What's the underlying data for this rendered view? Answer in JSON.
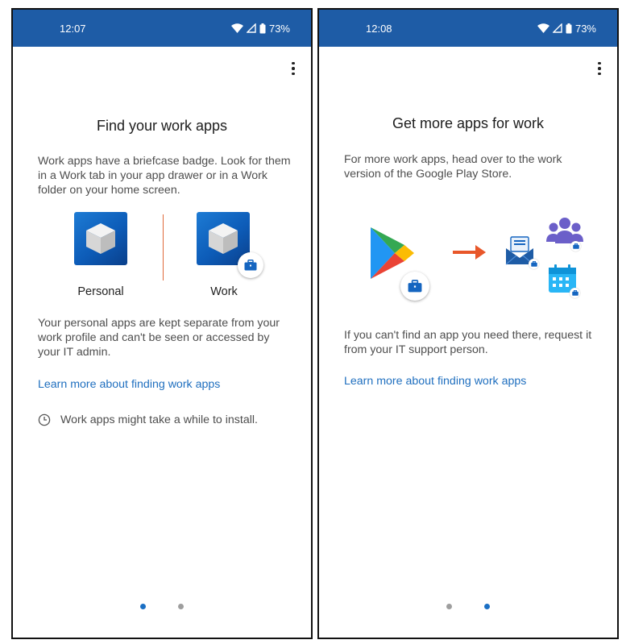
{
  "screens": [
    {
      "status": {
        "time": "12:07",
        "battery": "73%"
      },
      "title": "Find your work apps",
      "intro": "Work apps have a briefcase badge. Look for them in a Work tab in your app drawer or in a Work folder on your home screen.",
      "tiles": {
        "personal_label": "Personal",
        "work_label": "Work"
      },
      "separate": "Your personal apps are kept separate from your work profile and can't be seen or accessed by your IT admin.",
      "link": "Learn more about finding work apps",
      "note": "Work apps might take a while to install.",
      "pager": {
        "count": 2,
        "active": 0
      }
    },
    {
      "status": {
        "time": "12:08",
        "battery": "73%"
      },
      "title": "Get more apps for work",
      "intro": "For more work apps, head over to the work version of the Google Play Store.",
      "help": "If you can't find an app you need there, request it from your IT support person.",
      "link": "Learn more about finding work apps",
      "pager": {
        "count": 2,
        "active": 1
      }
    }
  ],
  "icons": {
    "status": [
      "wifi-icon",
      "cell-signal-icon",
      "battery-icon"
    ],
    "menu": "more-vert-icon",
    "note": "clock-icon",
    "apps": [
      "cube-app-icon",
      "briefcase-icon",
      "play-store-icon",
      "arrow-right-icon",
      "mail-icon",
      "people-icon",
      "calendar-icon"
    ]
  },
  "colors": {
    "status_bar": "#1e5ca6",
    "link": "#1f6fbf",
    "active_dot": "#1a6fc4",
    "inactive_dot": "#9e9e9e",
    "arrow": "#e8572a"
  }
}
